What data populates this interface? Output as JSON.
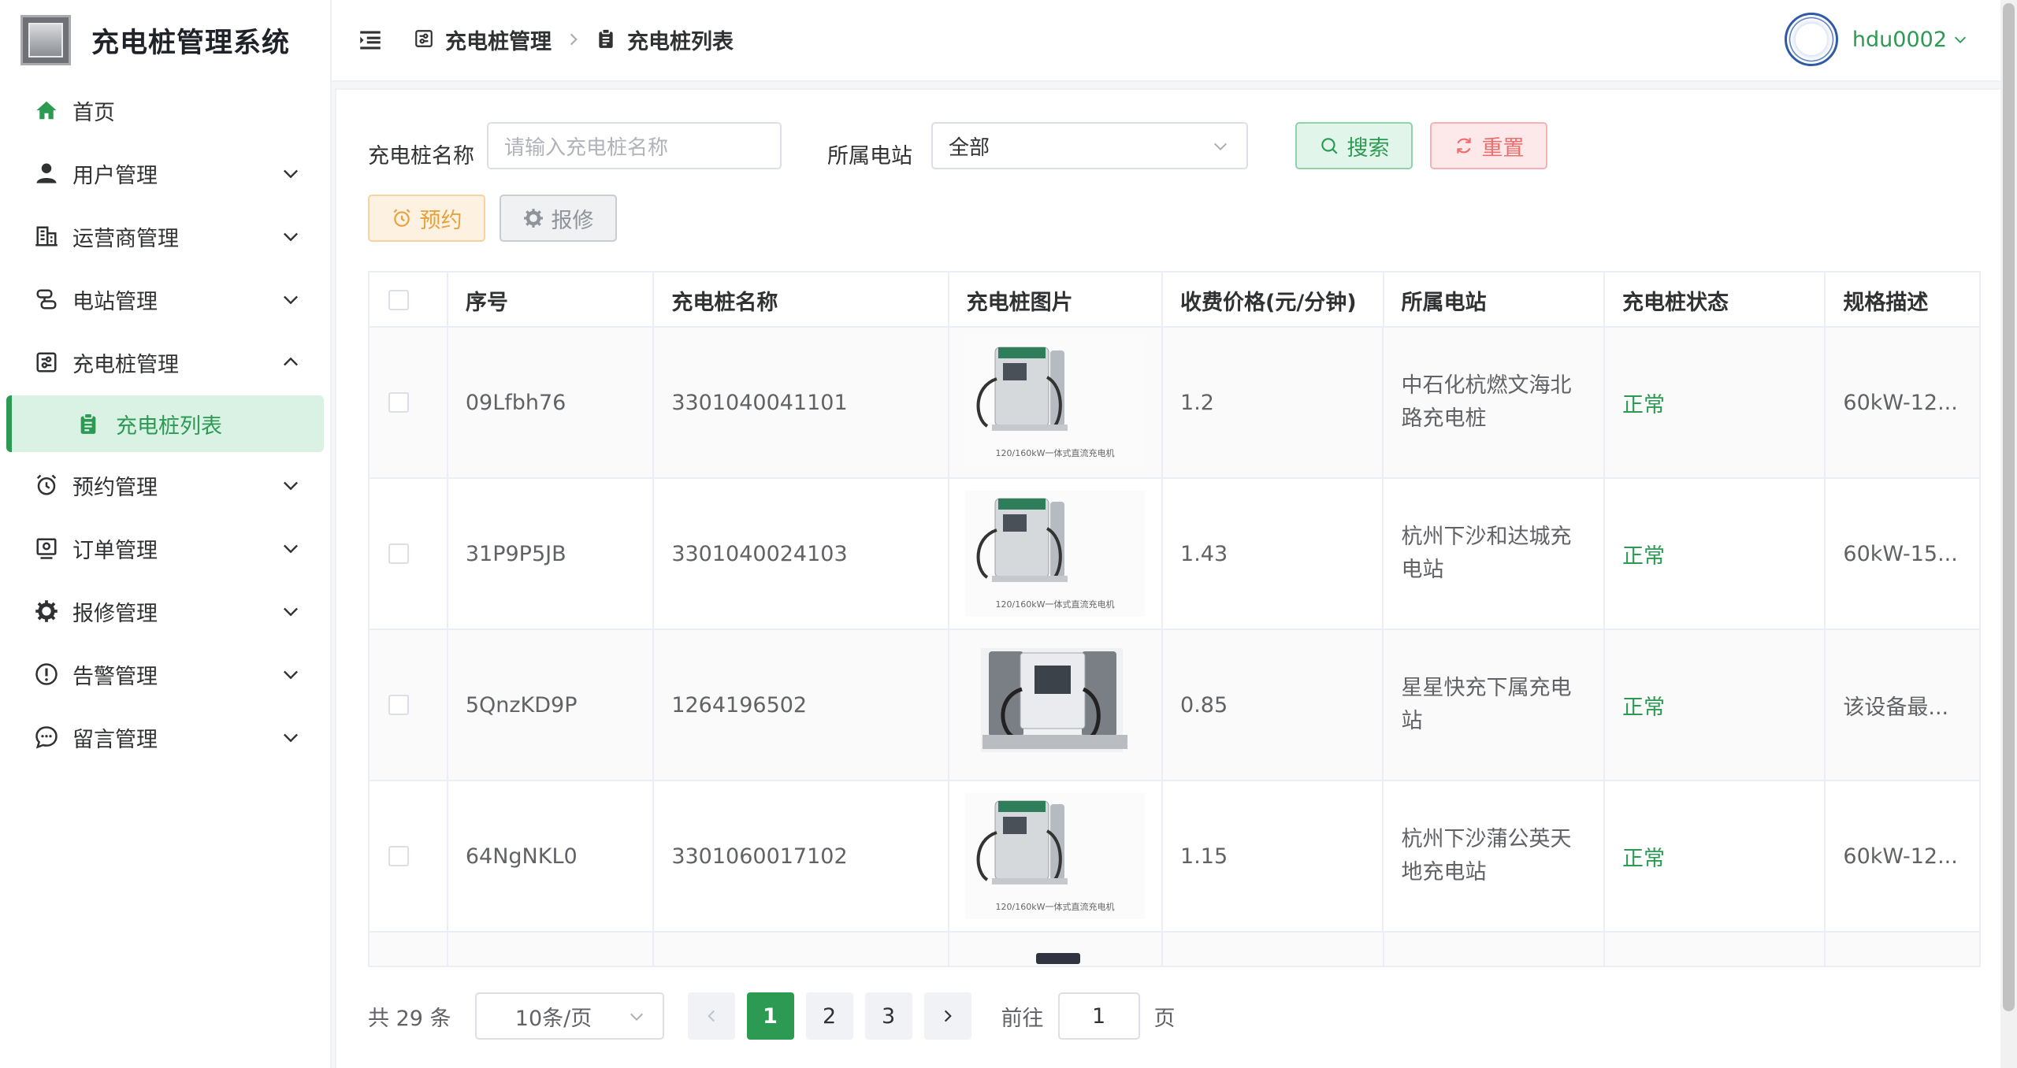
{
  "app": {
    "title": "充电桩管理系统"
  },
  "sidebar": {
    "items": [
      {
        "label": "首页",
        "icon": "home-icon"
      },
      {
        "label": "用户管理",
        "icon": "user-icon"
      },
      {
        "label": "运营商管理",
        "icon": "building-icon"
      },
      {
        "label": "电站管理",
        "icon": "station-icon"
      },
      {
        "label": "充电桩管理",
        "icon": "charger-icon",
        "expanded": true
      },
      {
        "label": "充电桩列表",
        "icon": "clipboard-icon",
        "active": true
      },
      {
        "label": "预约管理",
        "icon": "alarm-clock-icon"
      },
      {
        "label": "订单管理",
        "icon": "order-icon"
      },
      {
        "label": "报修管理",
        "icon": "gear-icon"
      },
      {
        "label": "告警管理",
        "icon": "warning-icon"
      },
      {
        "label": "留言管理",
        "icon": "chat-icon"
      }
    ]
  },
  "header": {
    "breadcrumb": [
      "充电桩管理",
      "充电桩列表"
    ],
    "username": "hdu0002"
  },
  "filters": {
    "name_label": "充电桩名称",
    "name_placeholder": "请输入充电桩名称",
    "station_label": "所属电站",
    "station_value": "全部",
    "search_label": "搜索",
    "reset_label": "重置",
    "book_label": "预约",
    "repair_label": "报修"
  },
  "table": {
    "columns": [
      "序号",
      "充电桩名称",
      "充电桩图片",
      "收费价格(元/分钟)",
      "所属电站",
      "充电桩状态",
      "规格描述"
    ],
    "rows": [
      {
        "id": "09Lfbh76",
        "name": "3301040041101",
        "caption": "120/160kW一体式直流充电机",
        "price": "1.2",
        "station_line1": "中石化杭燃文海北",
        "station_line2": "路充电桩",
        "status": "正常",
        "spec": "60kW-12..."
      },
      {
        "id": "31P9P5JB",
        "name": "3301040024103",
        "caption": "120/160kW一体式直流充电机",
        "price": "1.43",
        "station_line1": "杭州下沙和达城充",
        "station_line2": "电站",
        "status": "正常",
        "spec": "60kW-15..."
      },
      {
        "id": "5QnzKD9P",
        "name": "1264196502",
        "caption": "",
        "price": "0.85",
        "station_line1": "星星快充下属充电",
        "station_line2": "站",
        "status": "正常",
        "spec": "该设备最..."
      },
      {
        "id": "64NgNKL0",
        "name": "3301060017102",
        "caption": "120/160kW一体式直流充电机",
        "price": "1.15",
        "station_line1": "杭州下沙蒲公英天",
        "station_line2": "地充电站",
        "status": "正常",
        "spec": "60kW-12..."
      }
    ]
  },
  "pagination": {
    "total_text": "共 29 条",
    "page_size": "10条/页",
    "pages": [
      "1",
      "2",
      "3"
    ],
    "current": "1",
    "goto_label": "前往",
    "goto_value": "1",
    "goto_suffix": "页"
  },
  "colors": {
    "accent": "#2c9a53",
    "danger": "#ee6e6e",
    "warning": "#e6a23c"
  }
}
